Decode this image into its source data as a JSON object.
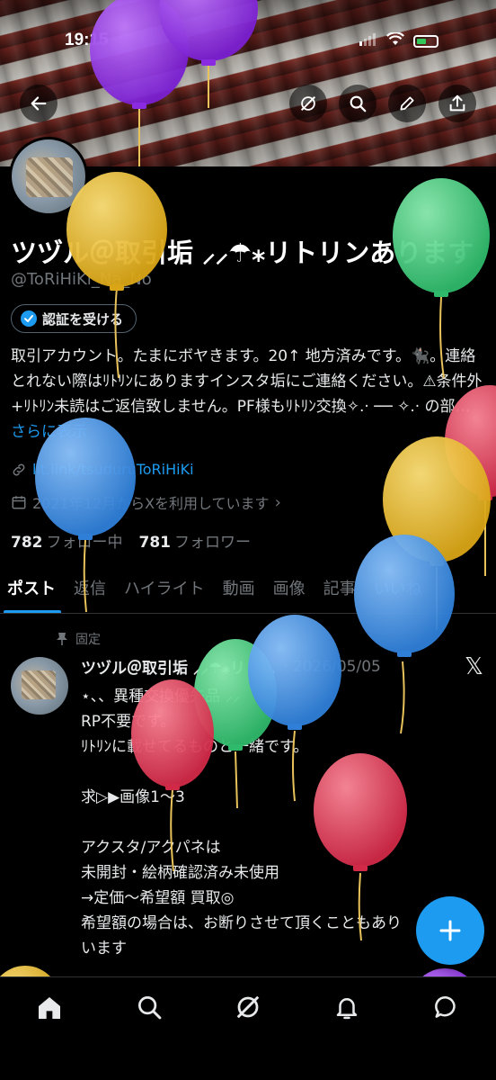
{
  "status_bar": {
    "time": "19:15"
  },
  "profile": {
    "display_name": "ツヅル＠取引垢 ⸝⸝☂︎⁎リトリンあります",
    "handle": "@ToRiHiKi_Na_No",
    "verify_label": "認証を受ける",
    "bio_text": "取引アカウント。たまにボヤきます。20↑ 地方済みです。🐈‍⬛。連絡とれない際はﾘﾄﾘﾝにありますインスタ垢にご連絡ください。⚠条件外 +ﾘﾄﾘﾝ未読はご返信致しません。PF様もﾘﾄﾘﾝ交換✧.· ── ✧.· の部…",
    "bio_more": "さらに表示",
    "link": "lit.link/tsuduruToRiHiKi",
    "joined": "2021年12月からXを利用しています",
    "following_count": "782",
    "following_label": "フォロー中",
    "followers_count": "781",
    "followers_label": "フォロワー"
  },
  "tabs": [
    {
      "label": "ポスト",
      "active": true
    },
    {
      "label": "返信",
      "active": false
    },
    {
      "label": "ハイライト",
      "active": false
    },
    {
      "label": "動画",
      "active": false
    },
    {
      "label": "画像",
      "active": false
    },
    {
      "label": "記事",
      "active": false
    },
    {
      "label": "いいね",
      "active": false
    }
  ],
  "post": {
    "pinned_label": "固定",
    "author": "ツヅル＠取引垢 ⸝⸝☂︎⁎リト…",
    "date": "· 2026/05/05",
    "lines": [
      "⋆、、異種交換優先品 ⸝⸝",
      "RP不要です。",
      "ﾘﾄﾘﾝに載せてるものと一緒です。",
      "",
      "求▷▶画像1〜3",
      "",
      "アクスタ/アクパネは",
      "未開封・絵柄確認済み未使用",
      "→定価〜希望額 買取◎",
      "希望額の場合は、お断りさせて頂くこともあり",
      "います"
    ]
  },
  "icons": {
    "back": "back-arrow-icon",
    "grok": "grok-icon",
    "search": "search-icon",
    "edit": "pencil-icon",
    "share": "share-icon",
    "verified": "verified-check-icon",
    "link": "link-icon",
    "calendar": "calendar-icon",
    "pin": "pin-icon",
    "x_logo": "x-logo-icon",
    "compose": "plus-icon",
    "nav_home": "home-icon",
    "nav_search": "search-icon",
    "nav_grok": "grok-icon",
    "nav_notifications": "bell-icon",
    "nav_messages": "message-icon"
  },
  "colors": {
    "accent": "#1d9bf0",
    "text": "#e7e9ea",
    "muted": "#71767b",
    "background": "#000000"
  }
}
